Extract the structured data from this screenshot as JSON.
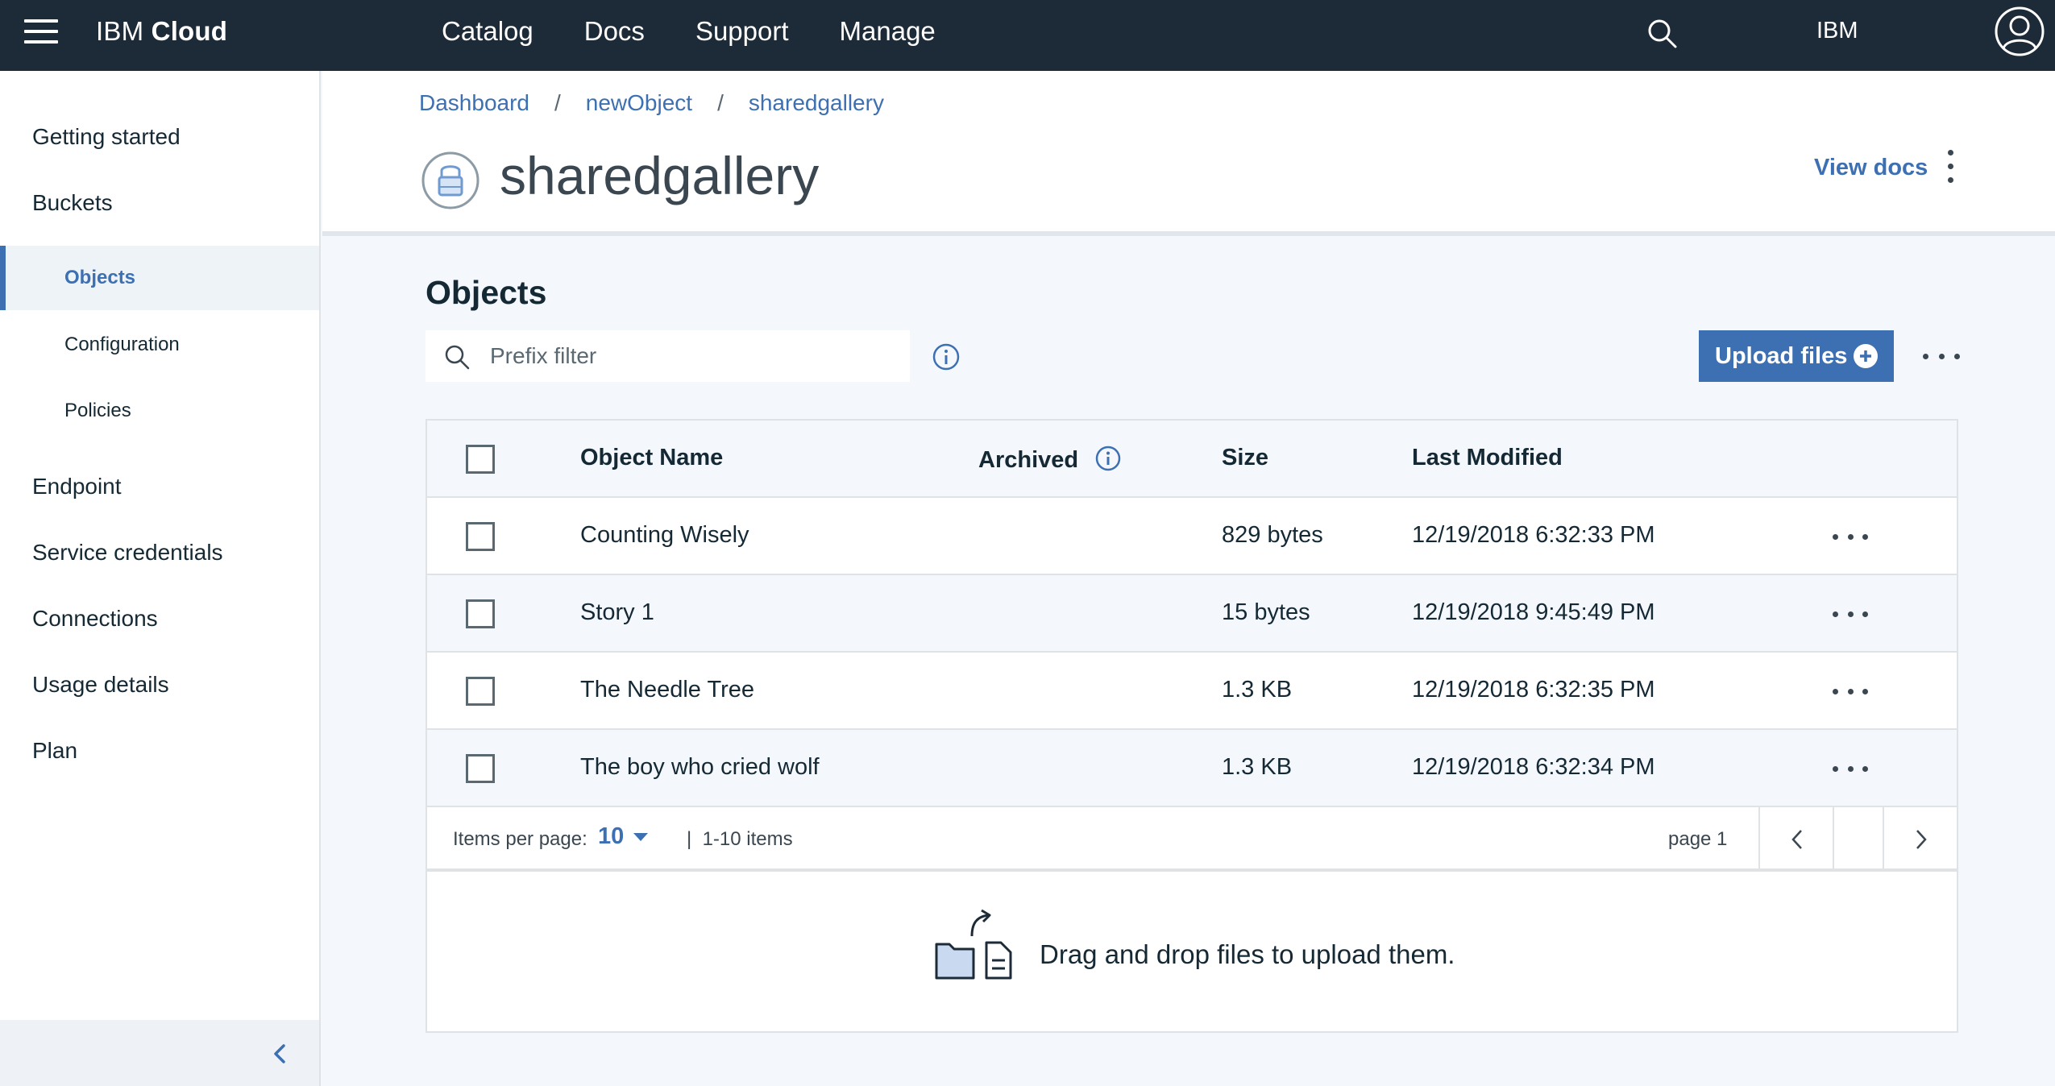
{
  "topbar": {
    "brand_prefix": "IBM",
    "brand_suffix": "Cloud",
    "nav": [
      "Catalog",
      "Docs",
      "Support",
      "Manage"
    ],
    "account": "IBM",
    "icons": {
      "menu": "hamburger-icon",
      "search": "search-icon",
      "avatar": "user-avatar-icon"
    }
  },
  "sidebar": {
    "items": [
      {
        "label": "Getting started"
      },
      {
        "label": "Buckets"
      },
      {
        "label": "Objects",
        "active": true
      },
      {
        "label": "Configuration"
      },
      {
        "label": "Policies"
      },
      {
        "label": "Endpoint"
      },
      {
        "label": "Service credentials"
      },
      {
        "label": "Connections"
      },
      {
        "label": "Usage details"
      },
      {
        "label": "Plan"
      }
    ],
    "collapse_icon": "chevron-left-icon"
  },
  "header": {
    "breadcrumbs": [
      "Dashboard",
      "newObject",
      "sharedgallery"
    ],
    "separator": "/",
    "title": "sharedgallery",
    "view_docs": "View docs"
  },
  "objects": {
    "title": "Objects",
    "filter_placeholder": "Prefix filter",
    "upload_label": "Upload files",
    "columns": {
      "name": "Object Name",
      "archived": "Archived",
      "size": "Size",
      "modified": "Last Modified"
    },
    "rows": [
      {
        "name": "Counting Wisely",
        "archived": "",
        "size": "829 bytes",
        "modified": "12/19/2018 6:32:33 PM"
      },
      {
        "name": "Story 1",
        "archived": "",
        "size": "15 bytes",
        "modified": "12/19/2018 9:45:49 PM"
      },
      {
        "name": "The Needle Tree",
        "archived": "",
        "size": "1.3 KB",
        "modified": "12/19/2018 6:32:35 PM"
      },
      {
        "name": "The boy who cried wolf",
        "archived": "",
        "size": "1.3 KB",
        "modified": "12/19/2018 6:32:34 PM"
      }
    ],
    "pagination": {
      "items_per_page_label": "Items per page:",
      "items_per_page": "10",
      "range": "|  1-10 items",
      "page": "page 1"
    },
    "dropzone_text": "Drag and drop files to upload them."
  },
  "colors": {
    "accent": "#3d70b2",
    "topbar": "#1d2b38",
    "background": "#f4f7fb"
  }
}
